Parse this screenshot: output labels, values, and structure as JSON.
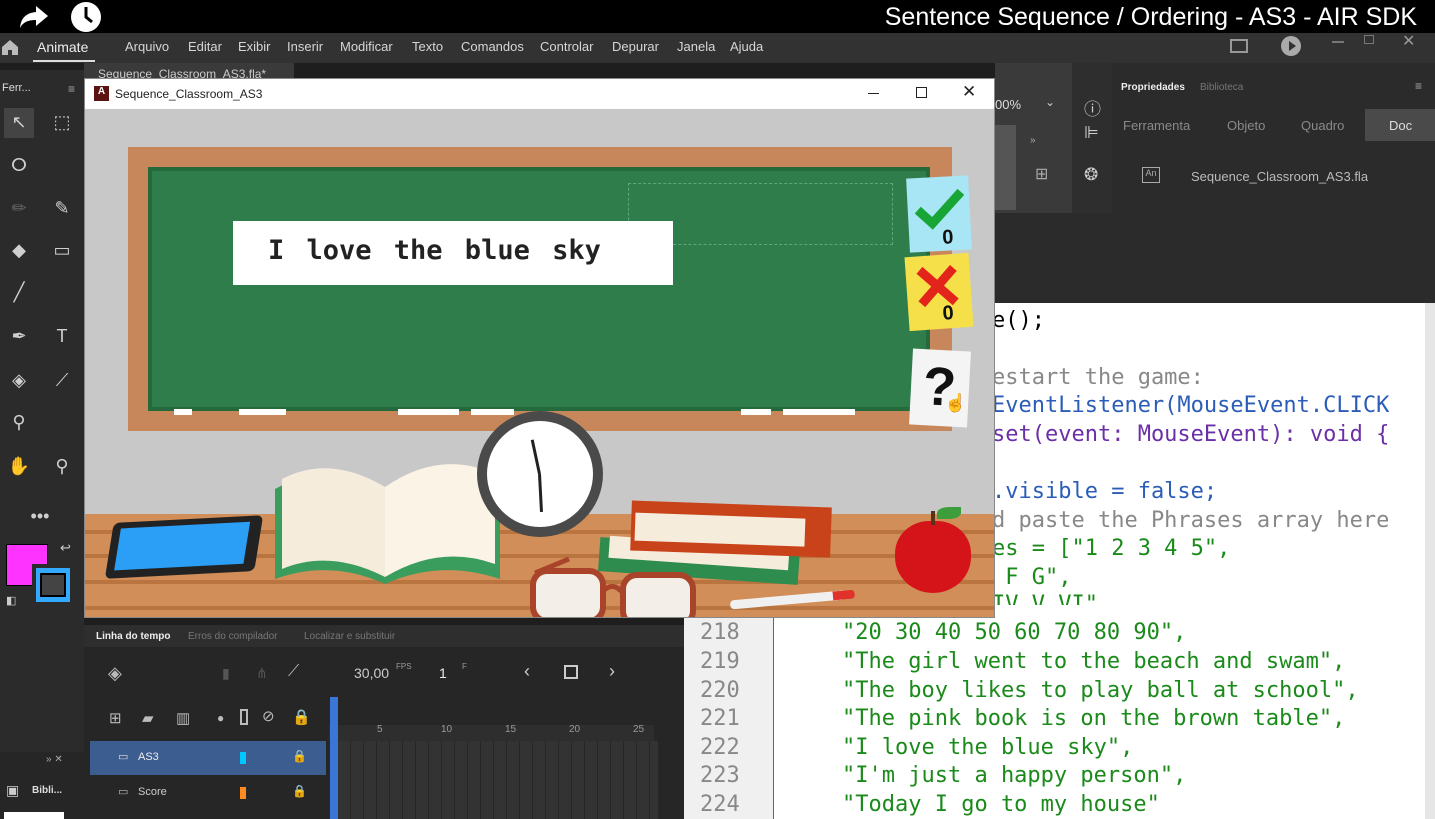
{
  "video": {
    "title": "Sentence Sequence / Ordering - AS3 - AIR SDK"
  },
  "app": {
    "name": "Animate",
    "menu": [
      "Arquivo",
      "Editar",
      "Exibir",
      "Inserir",
      "Modificar",
      "Texto",
      "Comandos",
      "Controlar",
      "Depurar",
      "Janela",
      "Ajuda"
    ],
    "doc_tab": "Sequence_Classroom_AS3.fla*",
    "tools_label": "Ferr...",
    "zoom": "00%"
  },
  "properties": {
    "tabs": [
      "Propriedades",
      "Biblioteca"
    ],
    "subtabs": [
      "Ferramenta",
      "Objeto",
      "Quadro",
      "Doc"
    ],
    "active_subtab": "Doc",
    "file": "Sequence_Classroom_AS3.fla"
  },
  "window": {
    "title": "Sequence_Classroom_AS3"
  },
  "game": {
    "sentence": "I love the blue sky",
    "correct_count": "0",
    "wrong_count": "0",
    "help_symbol": "?"
  },
  "timeline": {
    "tabs": [
      "Linha do tempo",
      "Erros do compilador",
      "Localizar e substituir"
    ],
    "fps": "30,00",
    "fps_unit": "FPS",
    "frame": "1",
    "frame_unit": "F",
    "ruler": [
      "5",
      "10",
      "15",
      "20",
      "25"
    ],
    "layers": [
      {
        "name": "AS3",
        "color": "#00c8ff"
      },
      {
        "name": "Score",
        "color": "#ff8a1e"
      }
    ],
    "library_label": "Bibli..."
  },
  "code": {
    "partial": [
      "e();",
      "estart the game:",
      "EventListener(MouseEvent.CLICK",
      "set(event: MouseEvent): void {",
      ".visible = false;",
      "d paste the Phrases array here",
      "es = [\"1 2 3 4 5\",",
      " F G\",",
      "IV V VI\","
    ],
    "lines": [
      {
        "n": "218",
        "t": "\"20 30 40 50 60 70 80 90\","
      },
      {
        "n": "219",
        "t": "\"The girl went to the beach and swam\","
      },
      {
        "n": "220",
        "t": "\"The boy likes to play ball at school\","
      },
      {
        "n": "221",
        "t": "\"The pink book is on the brown table\","
      },
      {
        "n": "222",
        "t": "\"I love the blue sky\","
      },
      {
        "n": "223",
        "t": "\"I'm just a happy person\","
      },
      {
        "n": "224",
        "t": "\"Today I go to my house\""
      }
    ]
  }
}
